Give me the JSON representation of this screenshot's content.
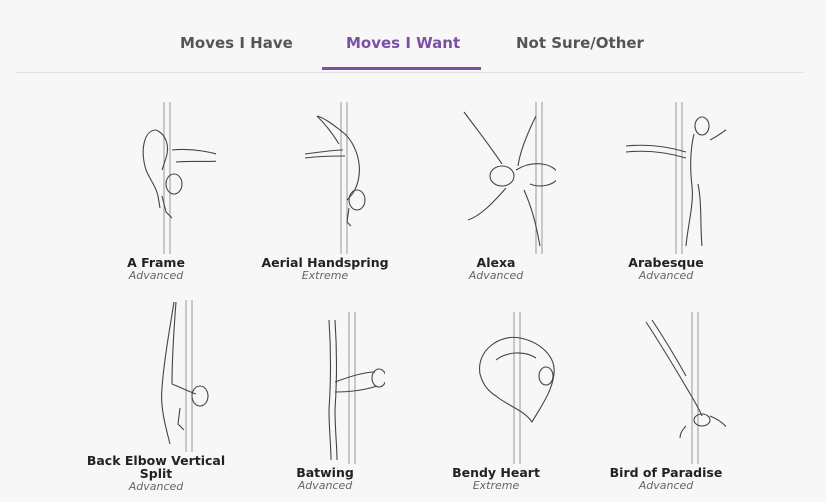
{
  "tabs": [
    {
      "label": "Moves I Have",
      "active": false
    },
    {
      "label": "Moves I Want",
      "active": true
    },
    {
      "label": "Not Sure/Other",
      "active": false
    }
  ],
  "accent_color": "#7b4fa6",
  "moves": [
    {
      "name": "A Frame",
      "level": "Advanced",
      "icon": "pole-pose-a-frame-icon"
    },
    {
      "name": "Aerial Handspring",
      "level": "Extreme",
      "icon": "pole-pose-aerial-handspring-icon"
    },
    {
      "name": "Alexa",
      "level": "Advanced",
      "icon": "pole-pose-alexa-icon"
    },
    {
      "name": "Arabesque",
      "level": "Advanced",
      "icon": "pole-pose-arabesque-icon"
    },
    {
      "name": "Back Elbow Vertical Split",
      "level": "Advanced",
      "icon": "pole-pose-back-elbow-vertical-split-icon"
    },
    {
      "name": "Batwing",
      "level": "Advanced",
      "icon": "pole-pose-batwing-icon"
    },
    {
      "name": "Bendy Heart",
      "level": "Extreme",
      "icon": "pole-pose-bendy-heart-icon"
    },
    {
      "name": "Bird of Paradise",
      "level": "Advanced",
      "icon": "pole-pose-bird-of-paradise-icon"
    }
  ]
}
